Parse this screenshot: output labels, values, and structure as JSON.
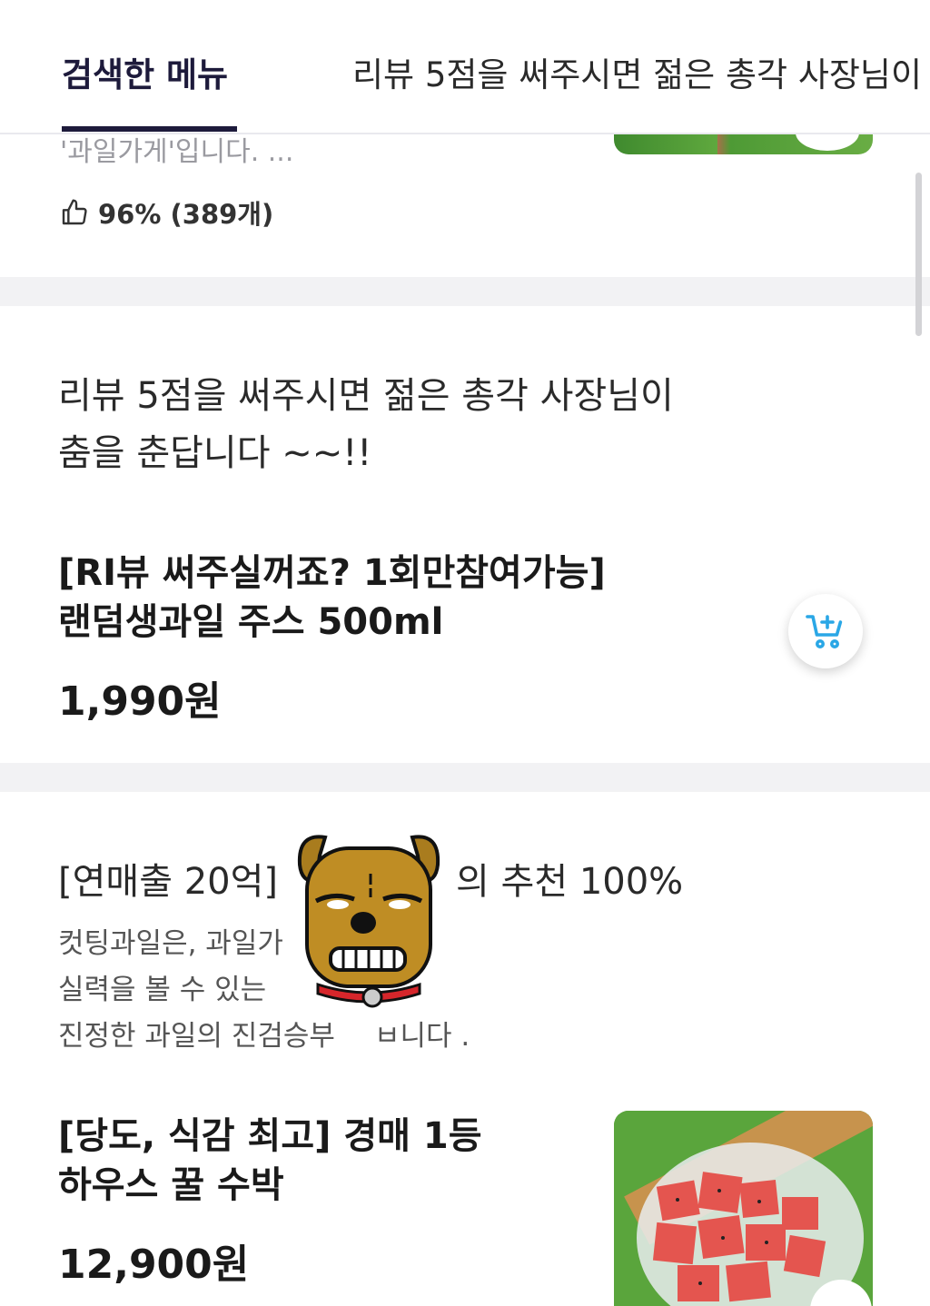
{
  "tabs": [
    {
      "label": "검색한 메뉴",
      "active": true
    },
    {
      "label": "리뷰 5점을 써주시면 젊은 총각 사장님이",
      "active": false
    }
  ],
  "previous_card": {
    "description_tail": "'과일가게'입니다. ...",
    "rating": "96% (389개)"
  },
  "card1": {
    "title_line1": "리뷰 5점을 써주시면 젊은 총각 사장님이",
    "title_line2": "춤을 춘답니다 ~~!!",
    "item_name_line1": "[RI뷰 써주실꺼죠? 1회만참여가능]",
    "item_name_line2": "랜덤생과일 주스 500ml",
    "price": "1,990원"
  },
  "card2": {
    "title_left": "[연매출 20억]",
    "title_right": "의 추천 100%",
    "desc_line1": "컷팅과일은, 과일가",
    "desc_line2": "실력을 볼 수 있는",
    "desc_line3": "진정한 과일의 진검승부",
    "desc_line3_tail": "ㅂ니다 .",
    "item_name_line1": "[당도, 식감 최고] 경매 1등",
    "item_name_line2": "하우스 꿀 수박",
    "price": "12,900원"
  },
  "colors": {
    "accent_navy": "#1d1a3b",
    "cart_blue": "#2aa7e6",
    "divider_gray": "#f2f2f4"
  },
  "icons": {
    "rating": "thumbs-up-icon",
    "add": "add-to-cart-icon",
    "sticker": "ryan-dog-sticker"
  }
}
